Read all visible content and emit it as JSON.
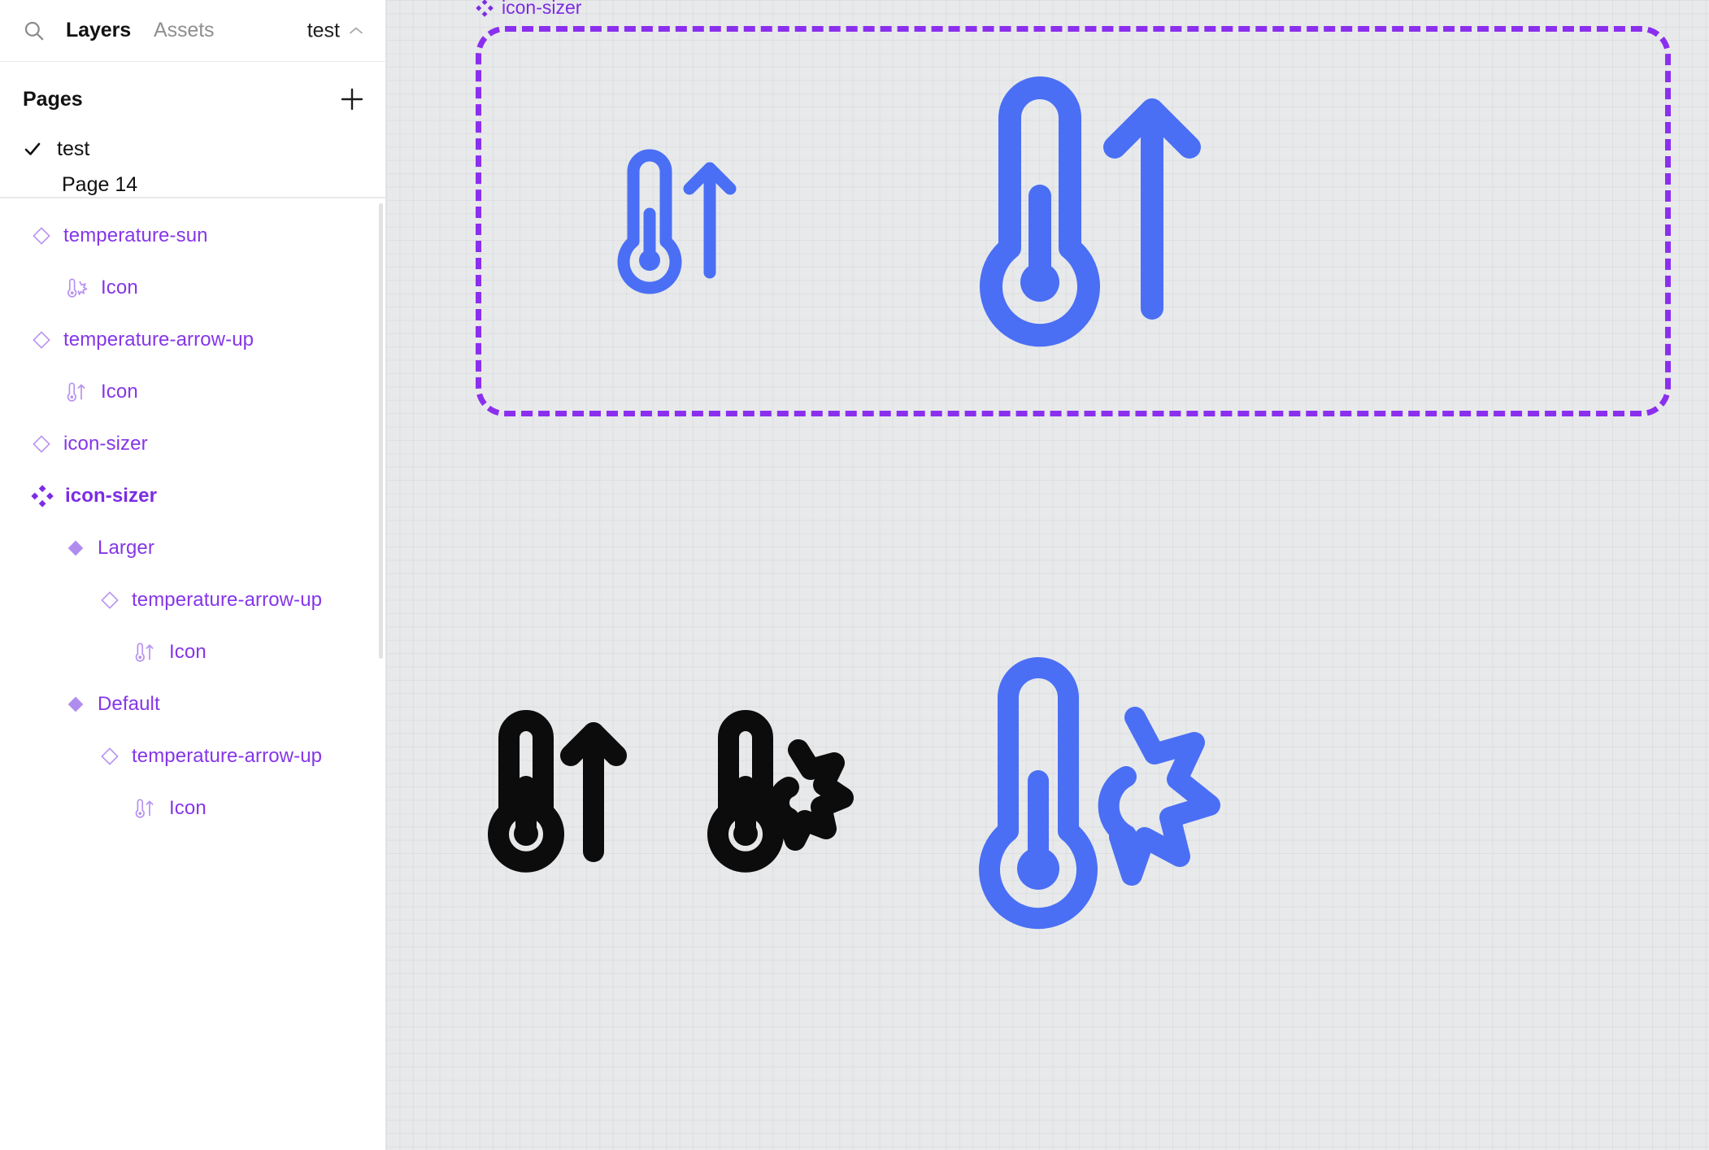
{
  "app": {
    "tool": "design-editor",
    "document_name": "test"
  },
  "sidebar": {
    "search_icon": "search-icon",
    "tabs": [
      {
        "label": "Layers",
        "active": true
      },
      {
        "label": "Assets",
        "active": false
      }
    ],
    "document_chip": {
      "name": "test",
      "chevron": "chevron-up-icon"
    },
    "pages": {
      "title": "Pages",
      "add_icon": "plus-icon",
      "items": [
        {
          "label": "test",
          "selected": true,
          "check_icon": "check-icon"
        },
        {
          "label": "Page 14",
          "selected": false,
          "clipped": true
        }
      ]
    },
    "layers": [
      {
        "label": "temperature-sun",
        "type": "component",
        "glyph": "diamond-outline-icon",
        "depth": 0
      },
      {
        "label": "Icon",
        "type": "icon-thumb",
        "glyph": "thermometer-sun-icon",
        "depth": 1
      },
      {
        "label": "temperature-arrow-up",
        "type": "component",
        "glyph": "diamond-outline-icon",
        "depth": 0
      },
      {
        "label": "Icon",
        "type": "icon-thumb",
        "glyph": "thermometer-arrow-up-icon",
        "depth": 1
      },
      {
        "label": "icon-sizer",
        "type": "component",
        "glyph": "diamond-outline-icon",
        "depth": 0
      },
      {
        "label": "icon-sizer",
        "type": "component-set",
        "glyph": "component-set-icon",
        "depth": 0,
        "selected": true
      },
      {
        "label": "Larger",
        "type": "variant",
        "glyph": "diamond-filled-icon",
        "depth": 1
      },
      {
        "label": "temperature-arrow-up",
        "type": "component",
        "glyph": "diamond-outline-icon",
        "depth": 2
      },
      {
        "label": "Icon",
        "type": "icon-thumb",
        "glyph": "thermometer-arrow-up-icon",
        "depth": 3
      },
      {
        "label": "Default",
        "type": "variant",
        "glyph": "diamond-filled-icon",
        "depth": 1
      },
      {
        "label": "temperature-arrow-up",
        "type": "component",
        "glyph": "diamond-outline-icon",
        "depth": 2
      },
      {
        "label": "Icon",
        "type": "icon-thumb",
        "glyph": "thermometer-arrow-up-icon",
        "depth": 3
      }
    ]
  },
  "canvas": {
    "selected_frame": {
      "name": "icon-sizer",
      "glyph": "component-set-icon",
      "border_style": "dashed",
      "border_color": "#8b2fee"
    },
    "artwork": [
      {
        "name": "temperature-arrow-up-small-blue",
        "icon": "thermometer-arrow-up-icon",
        "color": "#4a6ff5",
        "variant": "Default",
        "in_frame": true
      },
      {
        "name": "temperature-arrow-up-large-blue",
        "icon": "thermometer-arrow-up-icon",
        "color": "#4a6ff5",
        "variant": "Larger",
        "in_frame": true
      },
      {
        "name": "temperature-arrow-up-black",
        "icon": "thermometer-arrow-up-icon",
        "color": "#0c0c0c",
        "in_frame": false
      },
      {
        "name": "temperature-sun-black",
        "icon": "thermometer-sun-icon",
        "color": "#0c0c0c",
        "in_frame": false
      },
      {
        "name": "temperature-sun-blue",
        "icon": "thermometer-sun-icon",
        "color": "#4a6ff5",
        "in_frame": false
      }
    ]
  },
  "colors": {
    "accent_purple": "#8536e8",
    "frame_purple": "#8b2fee",
    "icon_blue": "#4a6ff5",
    "icon_black": "#0c0c0c",
    "canvas_bg": "#e8e9eb",
    "panel_bg": "#ffffff"
  }
}
